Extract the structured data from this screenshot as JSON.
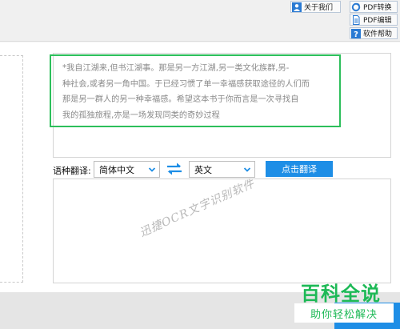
{
  "toolbar": {
    "about_label": "关于我们",
    "pdf_convert_label": "PDF转换",
    "pdf_edit_label": "PDF编辑",
    "help_label": "软件帮助"
  },
  "ocr": {
    "lines": [
      "*我自江湖来,但书江湖事。那是另一方江湖,另一类文化族群,另-",
      "种社会,或者另一角中国。于已经习惯了单一幸福感获取途径的人们而",
      "那是另一群人的另一种幸福感。希望这本书于你而言是一次寻找自",
      "我的孤独旅程,亦是一场发现同类的奇妙过程"
    ]
  },
  "translation": {
    "label": "语种翻译:",
    "source_language": "简体中文",
    "target_language": "英文",
    "translate_button": "点击翻译"
  },
  "watermark": "迅捷OCR文字识别软件",
  "brand": {
    "title": "百科全说",
    "slogan": "助你轻松解决"
  },
  "colors": {
    "accent_blue": "#1e8ee6",
    "highlight_green": "#2dbf5b",
    "brand_green": "#1db956"
  },
  "icons": {
    "about": "user-icon",
    "pdf_convert": "refresh-icon",
    "pdf_edit": "document-icon",
    "help": "question-icon",
    "swap": "swap-arrows-icon"
  }
}
